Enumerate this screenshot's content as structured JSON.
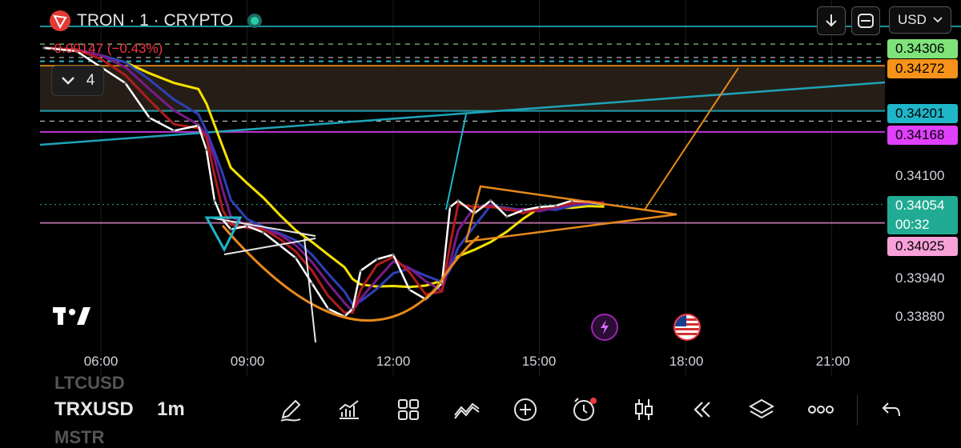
{
  "header": {
    "title": "TRON · 1 · CRYPTO",
    "change": "-0.00147 (−0.43%)",
    "indicator_count": "4",
    "currency": "USD",
    "tv_logo": "TV"
  },
  "price_labels": [
    {
      "value": "0.34306",
      "color": "#7fe37a"
    },
    {
      "value": "0.34272",
      "color": "#f7931a"
    },
    {
      "value": "0.34201",
      "color": "#1fb6c9"
    },
    {
      "value": "0.34168",
      "color": "#e040fb"
    },
    {
      "value": "0.34054",
      "time": "00:32",
      "color": "#22ab94"
    },
    {
      "value": "0.34025",
      "color": "#f7a1d8"
    }
  ],
  "bottom": {
    "symbol": "TRXUSD",
    "interval": "1m",
    "prev_symbol": "LTCUSD",
    "next_symbol": "MSTR",
    "tools": [
      "draw-icon",
      "indicators-icon",
      "grid-icon",
      "patterns-icon",
      "add-icon",
      "alert-icon",
      "candles-icon",
      "replay-icon",
      "layers-icon",
      "more-icon"
    ],
    "undo": "undo-icon"
  },
  "events": [
    {
      "icon": "lightning-icon",
      "color": "#9c27b0"
    },
    {
      "icon": "us-flag-icon",
      "color": "#f23645"
    }
  ],
  "chart_data": {
    "type": "line",
    "title": "",
    "xlabel": "",
    "ylabel": "",
    "x_ticks": [
      "06:00",
      "09:00",
      "12:00",
      "15:00",
      "18:00",
      "21:00"
    ],
    "y_ticks": [
      "0.34100",
      "0.33940",
      "0.33880"
    ],
    "ylim": [
      0.3386,
      0.3433
    ],
    "series": [
      {
        "values_x": [
          "04:50",
          "05:30",
          "06:00",
          "06:30",
          "07:00",
          "07:30",
          "08:00",
          "08:10",
          "08:20",
          "08:30",
          "08:40",
          "09:00",
          "09:20",
          "09:40",
          "10:00",
          "10:20",
          "10:40",
          "11:00",
          "11:10",
          "11:20",
          "11:40",
          "12:00",
          "12:20",
          "12:40",
          "13:00",
          "13:10",
          "13:20",
          "13:40",
          "14:00",
          "14:20",
          "14:40",
          "15:00",
          "15:20",
          "15:40",
          "16:00",
          "16:20"
        ],
        "values": [
          0.343,
          0.34295,
          0.3427,
          0.34245,
          0.3419,
          0.3417,
          0.34178,
          0.3414,
          0.3406,
          0.3403,
          0.34015,
          0.3402,
          0.3401,
          0.3399,
          0.3397,
          0.3393,
          0.3389,
          0.33878,
          0.3389,
          0.3395,
          0.33968,
          0.33975,
          0.3392,
          0.33905,
          0.3393,
          0.3405,
          0.3406,
          0.3404,
          0.3406,
          0.34035,
          0.34045,
          0.3405,
          0.34052,
          0.3406,
          0.34058,
          0.34054
        ]
      }
    ],
    "horizontal_levels": [
      0.34306,
      0.34272,
      0.34201,
      0.34168,
      0.34025
    ]
  }
}
